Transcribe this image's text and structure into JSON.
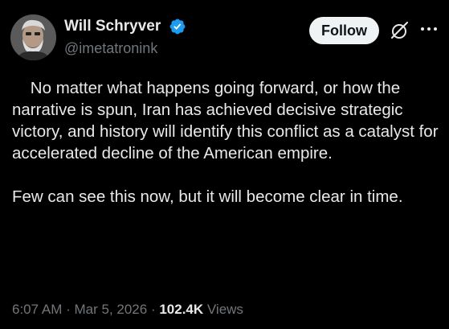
{
  "author": {
    "display_name": "Will Schryver",
    "handle": "@imetatronink",
    "verified": true
  },
  "header": {
    "follow_label": "Follow",
    "icons": [
      "verified-badge-icon",
      "grok-icon",
      "more-icon"
    ]
  },
  "tweet": {
    "paragraphs": [
      "    No matter what happens going forward, or how the narrative is spun, Iran has achieved decisive strategic victory, and history will identify this conflict as a catalyst for accelerated decline of the American empire.",
      "Few can see this now, but it will become clear in time."
    ]
  },
  "meta": {
    "time": "6:07 AM",
    "separator": " · ",
    "date": "Mar 5, 2026",
    "views_count": "102.4K",
    "views_label": " Views"
  },
  "colors": {
    "background": "#000000",
    "text_primary": "#e7e9ea",
    "text_secondary": "#71767b",
    "verified_blue": "#1d9bf0",
    "follow_bg": "#eff3f4"
  }
}
